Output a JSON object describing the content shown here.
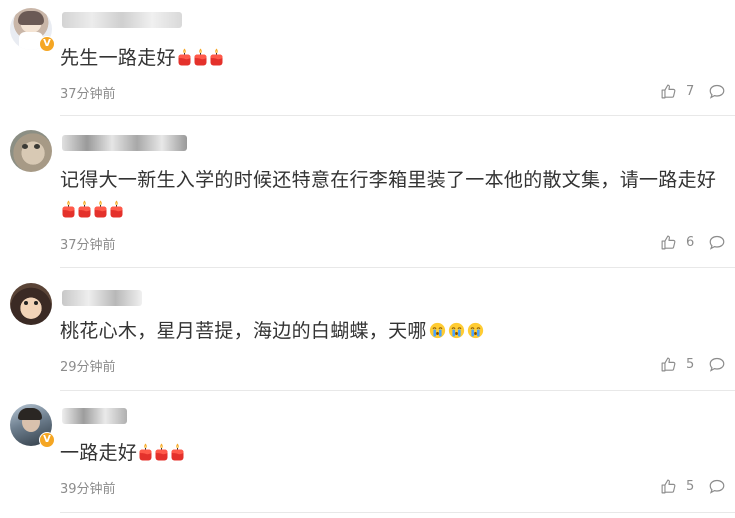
{
  "comments": [
    {
      "text": "先生一路走好",
      "emoji_candles": 3,
      "emoji_cry": 0,
      "time": "37分钟前",
      "likes": "7",
      "verified": true
    },
    {
      "text": "记得大一新生入学的时候还特意在行李箱里装了一本他的散文集，请一路走好",
      "emoji_candles": 4,
      "emoji_cry": 0,
      "time": "37分钟前",
      "likes": "6",
      "verified": false
    },
    {
      "text": "桃花心木，星月菩提，海边的白蝴蝶，天哪",
      "emoji_candles": 0,
      "emoji_cry": 3,
      "time": "29分钟前",
      "likes": "5",
      "verified": false
    },
    {
      "text": "一路走好",
      "emoji_candles": 3,
      "emoji_cry": 0,
      "time": "39分钟前",
      "likes": "5",
      "verified": true
    }
  ],
  "icons": {
    "like": "thumbs-up-icon",
    "reply": "comment-bubble-icon",
    "emoji_candle": "candle-icon",
    "emoji_cry": "crying-face-icon",
    "verified": "verified-v-badge-icon"
  },
  "colors": {
    "text": "#333333",
    "meta": "#8c8c8c",
    "divider": "#e8e8e8",
    "verified_badge": "#f5a623",
    "candle": "#e4312b"
  }
}
